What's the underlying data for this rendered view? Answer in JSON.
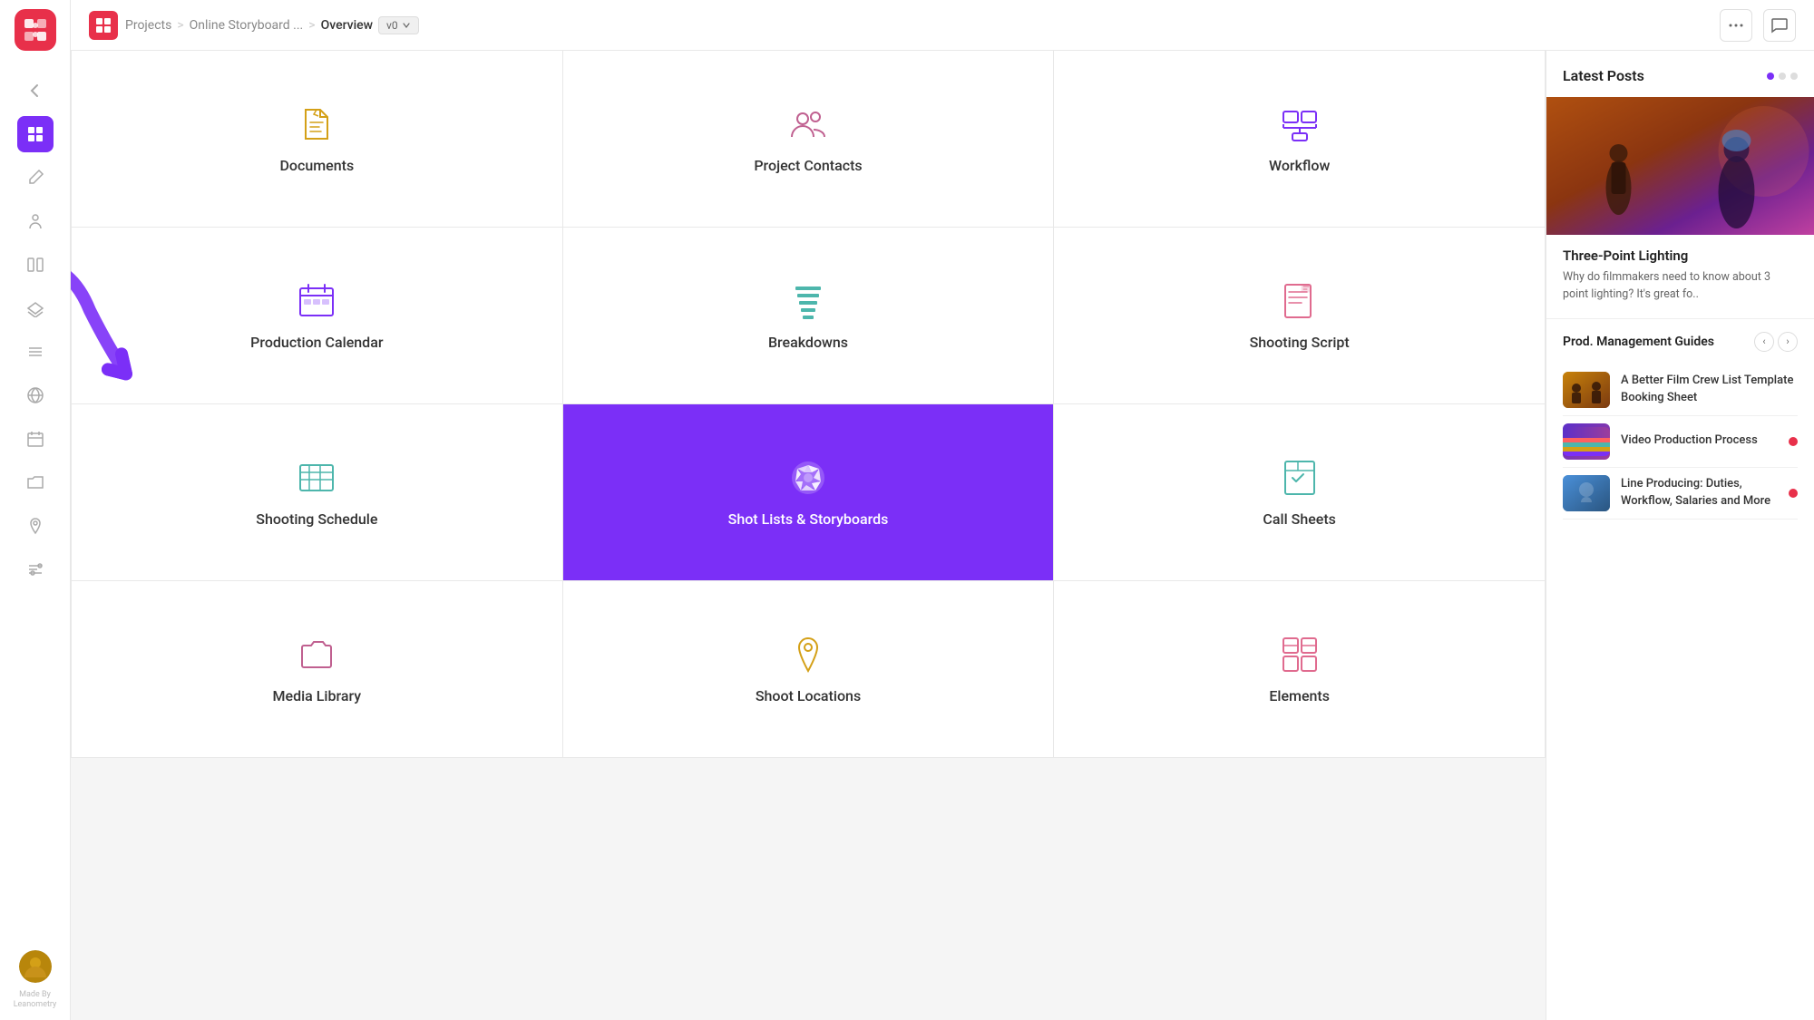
{
  "topbar": {
    "breadcrumb_projects": "Projects",
    "breadcrumb_sep1": ">",
    "breadcrumb_storyboard": "Online Storyboard ...",
    "breadcrumb_sep2": ">",
    "breadcrumb_overview": "Overview",
    "version": "v0"
  },
  "grid": {
    "cells": [
      {
        "id": "documents",
        "label": "Documents",
        "icon": "document",
        "active": false
      },
      {
        "id": "project-contacts",
        "label": "Project Contacts",
        "icon": "contacts",
        "active": false
      },
      {
        "id": "workflow",
        "label": "Workflow",
        "icon": "workflow",
        "active": false
      },
      {
        "id": "production-calendar",
        "label": "Production Calendar",
        "icon": "calendar",
        "active": false
      },
      {
        "id": "breakdowns",
        "label": "Breakdowns",
        "icon": "breakdowns",
        "active": false
      },
      {
        "id": "shooting-script",
        "label": "Shooting Script",
        "icon": "script",
        "active": false
      },
      {
        "id": "shooting-schedule",
        "label": "Shooting Schedule",
        "icon": "schedule",
        "active": false
      },
      {
        "id": "shot-lists",
        "label": "Shot Lists & Storyboards",
        "icon": "camera-spin",
        "active": true
      },
      {
        "id": "call-sheets",
        "label": "Call Sheets",
        "icon": "callsheets",
        "active": false
      },
      {
        "id": "media-library",
        "label": "Media Library",
        "icon": "folder",
        "active": false
      },
      {
        "id": "shoot-locations",
        "label": "Shoot Locations",
        "icon": "location",
        "active": false
      },
      {
        "id": "elements",
        "label": "Elements",
        "icon": "elements",
        "active": false
      }
    ]
  },
  "right_panel": {
    "latest_posts_title": "Latest Posts",
    "post_title": "Three-Point Lighting",
    "post_excerpt": "Why do filmmakers need to know about 3 point lighting? It's great fo..",
    "guides_title": "Prod. Management Guides",
    "guides": [
      {
        "id": "guide-1",
        "text": "A Better Film Crew List Template Booking Sheet",
        "has_dot": false
      },
      {
        "id": "guide-2",
        "text": "Video Production Process",
        "has_dot": true
      },
      {
        "id": "guide-3",
        "text": "Line Producing: Duties, Workflow, Salaries and More",
        "has_dot": true
      }
    ]
  },
  "sidebar": {
    "made_by": "Made By\nLeanometry"
  }
}
